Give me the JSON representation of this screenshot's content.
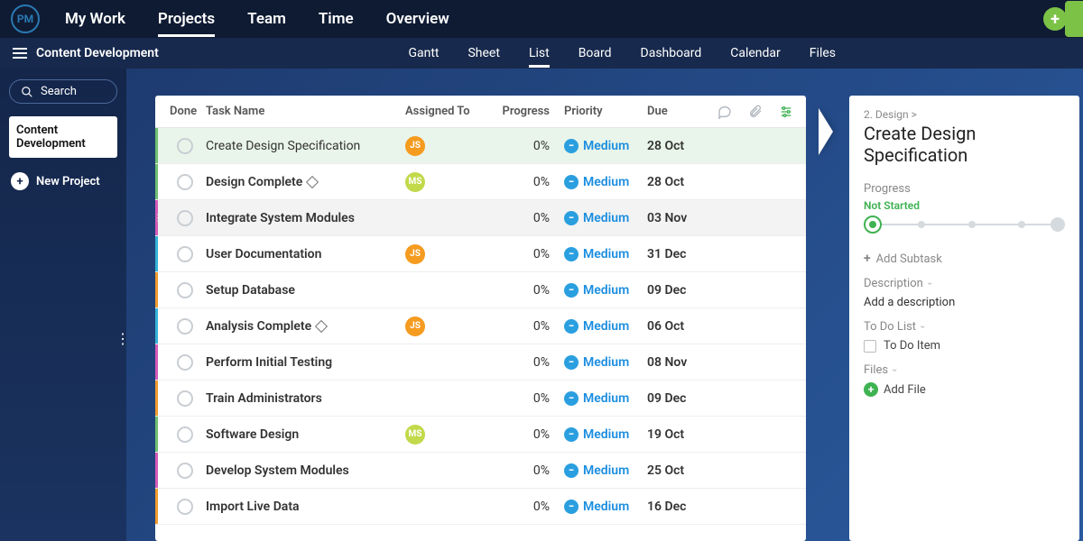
{
  "logo": "PM",
  "nav": [
    "My Work",
    "Projects",
    "Team",
    "Time",
    "Overview"
  ],
  "nav_active": 1,
  "crumb": "Content Development",
  "view_tabs": [
    "Gantt",
    "Sheet",
    "List",
    "Board",
    "Dashboard",
    "Calendar",
    "Files"
  ],
  "view_active": 2,
  "search_placeholder": "Search",
  "sidebar_item": "Content Development",
  "new_project": "New Project",
  "columns": {
    "done": "Done",
    "name": "Task Name",
    "assigned": "Assigned To",
    "progress": "Progress",
    "priority": "Priority",
    "due": "Due"
  },
  "rows": [
    {
      "name": "Create Design Specification",
      "assignee": "JS",
      "avatarClass": "JS",
      "progress": "0%",
      "priority": "Medium",
      "due": "28 Oct",
      "stripe": "#6fc06f",
      "selected": true,
      "milestone": false,
      "bold": false
    },
    {
      "name": "Design Complete",
      "assignee": "MS",
      "avatarClass": "MS",
      "progress": "0%",
      "priority": "Medium",
      "due": "28 Oct",
      "stripe": "#6fc06f",
      "milestone": true,
      "bold": true
    },
    {
      "name": "Integrate System Modules",
      "assignee": "",
      "avatarClass": "",
      "progress": "0%",
      "priority": "Medium",
      "due": "03 Nov",
      "stripe": "#d55bb8",
      "hover": true,
      "bold": true
    },
    {
      "name": "User Documentation",
      "assignee": "JS",
      "avatarClass": "JS",
      "progress": "0%",
      "priority": "Medium",
      "due": "31 Dec",
      "stripe": "#35b2d6",
      "bold": true
    },
    {
      "name": "Setup Database",
      "assignee": "",
      "avatarClass": "",
      "progress": "0%",
      "priority": "Medium",
      "due": "09 Dec",
      "stripe": "#f09a2e",
      "bold": true
    },
    {
      "name": "Analysis Complete",
      "assignee": "JS",
      "avatarClass": "JS",
      "progress": "0%",
      "priority": "Medium",
      "due": "06 Oct",
      "stripe": "#35b2d6",
      "milestone": true,
      "bold": true
    },
    {
      "name": "Perform Initial Testing",
      "assignee": "",
      "avatarClass": "",
      "progress": "0%",
      "priority": "Medium",
      "due": "08 Nov",
      "stripe": "#d55bb8",
      "bold": true
    },
    {
      "name": "Train Administrators",
      "assignee": "",
      "avatarClass": "",
      "progress": "0%",
      "priority": "Medium",
      "due": "09 Dec",
      "stripe": "#f09a2e",
      "bold": true
    },
    {
      "name": "Software Design",
      "assignee": "MS",
      "avatarClass": "MS",
      "progress": "0%",
      "priority": "Medium",
      "due": "19 Oct",
      "stripe": "#6fc06f",
      "bold": true
    },
    {
      "name": "Develop System Modules",
      "assignee": "",
      "avatarClass": "",
      "progress": "0%",
      "priority": "Medium",
      "due": "25 Oct",
      "stripe": "#d55bb8",
      "bold": true
    },
    {
      "name": "Import Live Data",
      "assignee": "",
      "avatarClass": "",
      "progress": "0%",
      "priority": "Medium",
      "due": "16 Dec",
      "stripe": "#f09a2e",
      "bold": true
    }
  ],
  "detail": {
    "breadcrumb": "2. Design >",
    "title": "Create Design Specification",
    "progress_label": "Progress",
    "status": "Not Started",
    "add_subtask": "Add Subtask",
    "description_label": "Description",
    "description_placeholder": "Add a description",
    "todo_label": "To Do List",
    "todo_item": "To Do Item",
    "files_label": "Files",
    "add_file": "Add File"
  }
}
